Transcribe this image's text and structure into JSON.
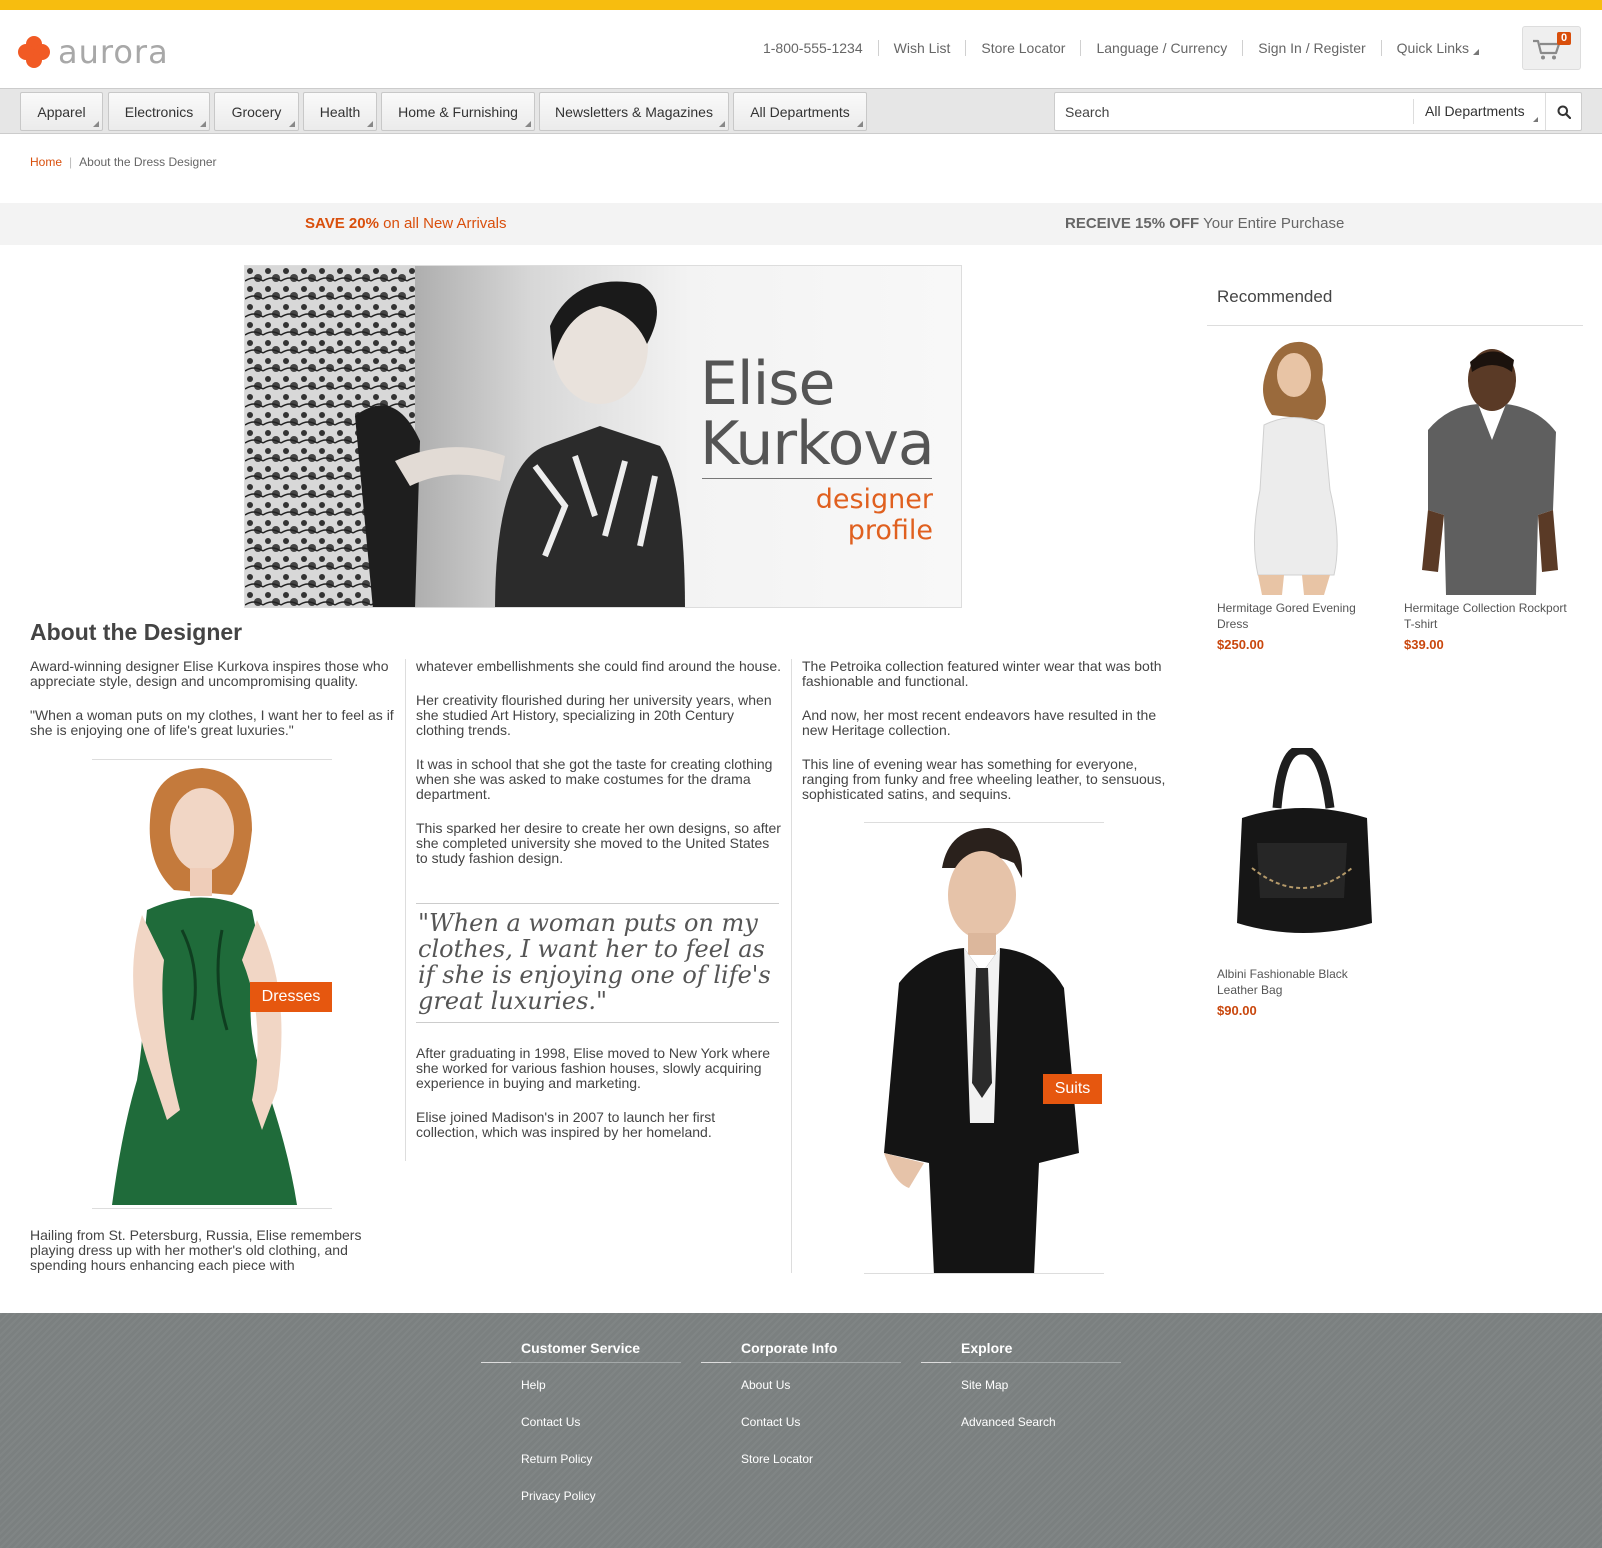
{
  "brand": {
    "name": "aurora",
    "accent": "#f15a24",
    "stripe": "#f7bd0f"
  },
  "util_links": [
    "1-800-555-1234",
    "Wish List",
    "Store Locator",
    "Language / Currency",
    "Sign In / Register",
    "Quick Links"
  ],
  "cart": {
    "count": "0",
    "icon": "cart-icon"
  },
  "nav": [
    "Apparel",
    "Electronics",
    "Grocery",
    "Health",
    "Home & Furnishing",
    "Newsletters & Magazines",
    "All Departments"
  ],
  "search": {
    "placeholder": "Search",
    "department": "All Departments",
    "icon": "search-icon"
  },
  "breadcrumb": {
    "home": "Home",
    "current": "About the Dress Designer"
  },
  "promos": {
    "left_bold": "SAVE 20%",
    "left_rest": " on all New Arrivals",
    "right_bold": "RECEIVE 15% OFF",
    "right_rest": " Your Entire Purchase"
  },
  "hero": {
    "first": "Elise",
    "last": "Kurkova",
    "sub1": "designer",
    "sub2": "profile"
  },
  "about": {
    "title": "About the Designer",
    "col1": [
      "Award-winning designer Elise Kurkova inspires those who appreciate style, design and uncompromising quality.",
      "\"When a woman puts on my clothes, I want her to feel as if she is enjoying one of life's great luxuries.\""
    ],
    "col1_after": "Hailing from St. Petersburg, Russia, Elise remembers playing dress up with her mother's old clothing, and spending hours enhancing each piece with",
    "col2": [
      "whatever embellishments she could find around the house.",
      "Her creativity flourished during her university years, when she studied Art History, specializing in 20th Century clothing trends.",
      "It was in school that she got the taste for creating clothing when she was asked to make costumes for the drama department.",
      "This sparked her desire to create her own designs, so after she completed university she moved to the United States to study fashion design."
    ],
    "quote": "\"When a woman puts on my clothes, I want her to feel as if she is enjoying one of life's great luxuries.\"",
    "col2_after": [
      "After graduating in 1998, Elise moved to New York where she worked for various fashion houses, slowly acquiring experience in buying and marketing.",
      "Elise joined Madison's in 2007 to launch her first collection, which was inspired by her homeland."
    ],
    "col3": [
      "The Petroika collection featured winter wear that was both fashionable and functional.",
      "And now, her most recent endeavors have resulted in the new Heritage collection.",
      "This line of evening wear has something for everyone, ranging from funky and free wheeling leather, to sensuous, sophisticated satins, and sequins."
    ],
    "badges": {
      "dresses": "Dresses",
      "suits": "Suits"
    }
  },
  "recommended": {
    "title": "Recommended",
    "items": [
      {
        "name": "Hermitage Gored Evening Dress",
        "price": "$250.00"
      },
      {
        "name": "Hermitage Collection Rockport T-shirt",
        "price": "$39.00"
      },
      {
        "name": "Albini Fashionable Black Leather Bag",
        "price": "$90.00"
      }
    ]
  },
  "footer": {
    "customer_service": {
      "title": "Customer Service",
      "links": [
        "Help",
        "Contact Us",
        "Return Policy",
        "Privacy Policy"
      ]
    },
    "corporate": {
      "title": "Corporate Info",
      "links": [
        "About Us",
        "Contact Us",
        "Store Locator"
      ]
    },
    "explore": {
      "title": "Explore",
      "links": [
        "Site Map",
        "Advanced Search"
      ]
    }
  }
}
